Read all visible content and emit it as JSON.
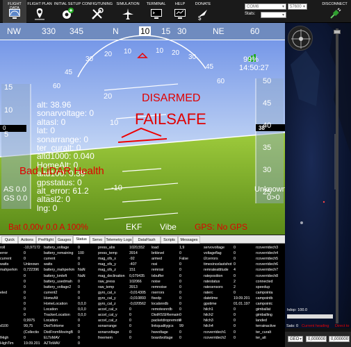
{
  "toolbar": {
    "items": [
      {
        "id": "flight-data",
        "label": "FLIGHT DATA",
        "icon": "monitor-gauge-icon",
        "active": true
      },
      {
        "id": "flight-plan",
        "label": "FLIGHT PLAN",
        "icon": "map-pin-icon"
      },
      {
        "id": "initial-setup",
        "label": "INITIAL SETUP",
        "icon": "setup-gear-plus-icon"
      },
      {
        "id": "config-tuning",
        "label": "CONFIG/TUNING",
        "icon": "wrench-screwdriver-icon"
      },
      {
        "id": "simulation",
        "label": "SIMULATION",
        "icon": "plane-icon"
      },
      {
        "id": "terminal",
        "label": "TERMINAL",
        "icon": "terminal-monitor-icon"
      },
      {
        "id": "help",
        "label": "HELP",
        "icon": "help-monitor-icon"
      },
      {
        "id": "donate",
        "label": "DONATE",
        "icon": "donate-plane-icon"
      }
    ],
    "port": "COM6",
    "baud": "57600",
    "stats_label": "Stats:",
    "disconnect": "DISCONNECT"
  },
  "hud": {
    "heading_tape": [
      "NW",
      "330",
      "345",
      "N",
      "10",
      "15",
      "30",
      "NE",
      "60"
    ],
    "heading_current": "10",
    "battery_percent": "99%",
    "time": "14:50:27",
    "armed_status": "DISARMED",
    "failsafe": "FAILSAFE",
    "left_scale": [
      "15",
      "10",
      "5"
    ],
    "left_current": "0",
    "airspeed": "AS 0.0",
    "groundspeed": "GS 0.0",
    "right_scale": [
      "50",
      "45",
      "40",
      "35",
      "30",
      "25"
    ],
    "right_current": "38",
    "mode": "Unknown",
    "wp": "0>0",
    "pitch_up": [
      "20",
      "10"
    ],
    "pitch_down": [
      "-10"
    ],
    "roll": [
      "60",
      "45",
      "30",
      "20",
      "10",
      "10",
      "20",
      "30",
      "45",
      "60"
    ],
    "overlay": [
      "alt: 38.96",
      "sonarvoltage: 0",
      "altasl: 0",
      "lat: 0",
      "sonarrange: 0",
      "ter_curalt: 0",
      "altd1000: 0.040",
      "HomeAlt: 0",
      "altd100: 0.39",
      "gpsstatus: 0",
      "alt_error: 61.2",
      "altasl2: 0",
      "lng: 0"
    ],
    "lidar_warning": "Bad LiDAR Health",
    "battery": "Bat 0,00v 0,0 A 100%",
    "ekf": "EKF",
    "vibe": "Vibe",
    "gps": "GPS: No GPS"
  },
  "tabs": [
    "Quick",
    "Actions",
    "PreFlight",
    "Gauges",
    "Status",
    "Servo",
    "Telemetry Logs",
    "DataFlash Logs",
    "Scripts",
    "Messages"
  ],
  "status_columns": [
    [
      "roll",
      "error",
      "current",
      "watts",
      "mahperkm",
      "",
      "",
      "",
      "eled",
      "",
      "",
      "",
      "",
      "",
      "d100",
      "",
      "fHigh",
      "HighTim"
    ],
    [
      "-10,97172",
      "0",
      "0",
      "Unknown",
      "0,722396",
      "0",
      "0",
      "0",
      "0",
      "0",
      "0",
      "0",
      "0",
      "0,9975",
      "99,75",
      "(Collectio",
      "0",
      "19.09.201"
    ],
    [
      "battery_voltage",
      "battery_remaining",
      "current",
      "watts",
      "battery_mahperkm",
      "battery_kmleft",
      "battery_usedmah",
      "battery_voltage2",
      "current2",
      "HomeAlt",
      "HomeLocation",
      "Location",
      "TrackerLocation",
      "Location",
      "DistToHome",
      "DistFromMovingB",
      "ELToMAV",
      "AZToMAV"
    ],
    [
      "0",
      "100",
      "0",
      "0",
      "NaN",
      "NaN",
      "0",
      "0",
      "0",
      "0",
      "0,0,0",
      "0,0,0",
      "0,0,0",
      "0",
      "0",
      "0",
      "0",
      "0"
    ],
    [
      "press_abs",
      "press_temp",
      "mag_ofs_x",
      "mag_ofs_y",
      "mag_ofs_z",
      "mag_declination",
      "raw_press",
      "raw_temp",
      "gyro_cal_x",
      "gyro_cal_y",
      "gyro_cal_z",
      "accel_cal_x",
      "accel_cal_y",
      "accel_cal_z",
      "sonarrange",
      "sonarvoltage",
      "freemem",
      ""
    ],
    [
      "1020,552",
      "3914",
      "-92",
      "-407",
      "151",
      "0,079435",
      "102066",
      "3913",
      "-0,014305",
      "-0,010893",
      "-0,020562",
      "0",
      "0",
      "0",
      "0",
      "0",
      "0",
      ""
    ],
    [
      "load",
      "brklevel",
      "armed",
      "rssi",
      "remrssi",
      "txbuffer",
      "noise",
      "remnoise",
      "rxerrors",
      "fixedp",
      "localsnrdb",
      "remotesnrdb",
      "DistRSSIRemain",
      "packetdropremote",
      "linkqualitygcs",
      "hwvoltage",
      "boardvoltage",
      ""
    ],
    [
      "1,9",
      "0",
      "False",
      "0",
      "0",
      "0",
      "0",
      "0",
      "0",
      "0",
      "0",
      "0",
      "0",
      "0",
      "99",
      "0",
      "0",
      ""
    ],
    [
      "servovoltage",
      "voltageflag",
      "i2cerrors",
      "timesincelastshot",
      "remrateattitude",
      "rateposition",
      "ratestatus",
      "ratesensors",
      "raterc",
      "datetime",
      "gpstime",
      "hilch1",
      "hilch2",
      "hilch3",
      "hilch4",
      "rcoverridech1",
      "rcoverridech2",
      ""
    ],
    [
      "0",
      "0",
      "0",
      "0",
      "4",
      "0",
      "2",
      "2",
      "0",
      "19.09.201",
      "01.01.197",
      "0",
      "0",
      "0",
      "0",
      "0",
      "0",
      ""
    ],
    [
      "rcoverridech3",
      "rcoverridech4",
      "rcoverridech5",
      "rcoverridech6",
      "rcoverridech7",
      "rcoverridech8",
      "connected",
      "speedup",
      "campointa",
      "campointb",
      "campointc",
      "gimballat",
      "gimballing",
      "landed",
      "terrainactive",
      "ter_curalt",
      "ter_alt",
      ""
    ]
  ],
  "map": {
    "hdop": "hdop: 100.0",
    "sats": "Sats: 0",
    "current_heading": "Current heading",
    "direct_to": "Direct to",
    "geo": "GEO",
    "coord1": "0,000000",
    "coord2": "0,000000"
  }
}
